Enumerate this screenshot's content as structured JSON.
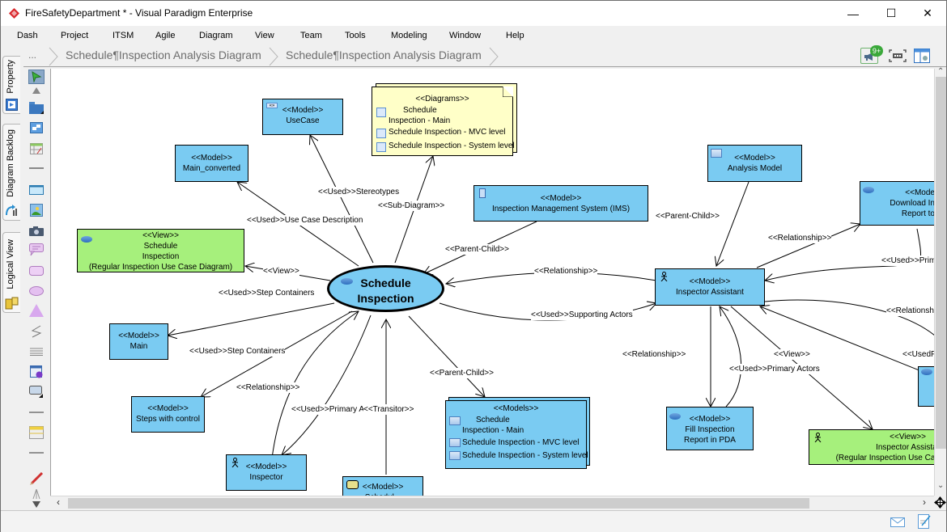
{
  "window": {
    "title": "FireSafetyDepartment * - Visual Paradigm Enterprise",
    "minimize": "—",
    "maximize": "☐",
    "close": "✕"
  },
  "menu": [
    "Dash",
    "Project",
    "ITSM",
    "Agile",
    "Diagram",
    "View",
    "Team",
    "Tools",
    "Modeling",
    "Window",
    "Help"
  ],
  "breadcrumb": {
    "more": "...",
    "items": [
      "Schedule¶Inspection Analysis Diagram",
      "Schedule¶Inspection Analysis Diagram"
    ]
  },
  "toolbar_right": {
    "notifications_badge": "9+",
    "notifications_icon": "megaphone-icon",
    "fit_icon": "fit-diagram-icon",
    "layout_icon": "layout-panel-icon"
  },
  "side_tabs": [
    "Property",
    "Diagram Backlog",
    "Logical View"
  ],
  "tools": [
    "selector",
    "scroll-up",
    "package",
    "subsystem",
    "table",
    "line",
    "rectangle",
    "image",
    "camera",
    "callout",
    "rounded-rect",
    "oval",
    "triangle",
    "zigzag",
    "text-lines",
    "info-table",
    "model-element",
    "separator-line",
    "legend-table",
    "separator-line-2",
    "pencil",
    "more",
    "scroll-down"
  ],
  "diagram": {
    "center": {
      "title": "Schedule\nInspection",
      "line1": "Schedule",
      "line2": "Inspection"
    },
    "nodes": {
      "usecase": {
        "stereo": "<<Model>>",
        "name": "UseCase"
      },
      "main_converted": {
        "stereo": "<<Model>>",
        "name": "Main_converted"
      },
      "diagrams": {
        "stereo": "<<Diagrams>>",
        "items": [
          "Schedule",
          "Inspection - Main",
          "Schedule Inspection - MVC level",
          "Schedule Inspection - System level"
        ]
      },
      "view_schedule": {
        "stereo": "<<View>>",
        "line1": "Schedule",
        "line2": "Inspection",
        "line3": "(Regular Inspection Use Case Diagram)"
      },
      "ims": {
        "stereo": "<<Model>>",
        "name": "Inspection Management System (IMS)"
      },
      "analysis_model": {
        "stereo": "<<Model>>",
        "name": "Analysis Model"
      },
      "download": {
        "stereo": "<<Mode",
        "line1": "Download In",
        "line2": "Report to"
      },
      "inspector_assistant": {
        "stereo": "<<Model>>",
        "name": "Inspector Assistant"
      },
      "main": {
        "stereo": "<<Model>>",
        "name": "Main"
      },
      "steps_control": {
        "stereo": "<<Model>>",
        "name": "Steps with control"
      },
      "inspector": {
        "stereo": "<<Model>>",
        "name": "Inspector"
      },
      "schedule_partial": {
        "stereo": "<<Model>>",
        "name": "Schedul..."
      },
      "models": {
        "stereo": "<<Models>>",
        "items": [
          "Schedule",
          "Inspection - Main",
          "Schedule Inspection - MVC level",
          "Schedule Inspection - System level"
        ]
      },
      "fill_report": {
        "stereo": "<<Model>>",
        "line1": "Fill Inspection",
        "line2": "Report in PDA"
      },
      "view_assistant": {
        "stereo": "<<View>>",
        "line1": "Inspector Assistant",
        "line2": "(Regular Inspection Use Case"
      }
    },
    "labels": {
      "used_stereotypes": {
        "a": "<<Used>>",
        "b": "Stereotypes"
      },
      "sub_diagram": "<<Sub-Diagram>>",
      "used_ucdesc": {
        "a": "<<Used>>",
        "b": "Use Case Description"
      },
      "view_left": "<<View>>",
      "parent_child_ims": "<<Parent-Child>>",
      "parent_child_right": "<<Parent-Child>>",
      "relationship_mid": "<<Relationship>>",
      "used_step1": {
        "a": "<<Used>>",
        "b": "Step Containers"
      },
      "used_supporting": {
        "a": "<<Used>>",
        "b": "Supporting Actors"
      },
      "used_step2": {
        "a": "<<Used>>",
        "b": "Step Containers"
      },
      "relationship_low": "<<Relationship>>",
      "used_primary_low": {
        "a": "<<Used>>",
        "b": "Primary Actors"
      },
      "transitor": "<<Transitor>>",
      "parent_child_low": "<<Parent-Child>>",
      "relationship_right_top": "<<Relationship>>",
      "used_primary_right": {
        "a": "<<Used>>",
        "b": "Primary Actor"
      },
      "relationship_right_mid": "<<Relationship>",
      "relationship_ia_low": "<<Relationship>>",
      "used_primary_ia": {
        "a": "<<Used>>",
        "b": "Primary Actors"
      },
      "view_right": "<<View>>",
      "used_primary_far": {
        "a": "<<Used",
        "b": "Primary A"
      }
    }
  },
  "statusbar": {
    "mail_icon": "mail-icon",
    "notes_icon": "edit-notes-icon"
  }
}
